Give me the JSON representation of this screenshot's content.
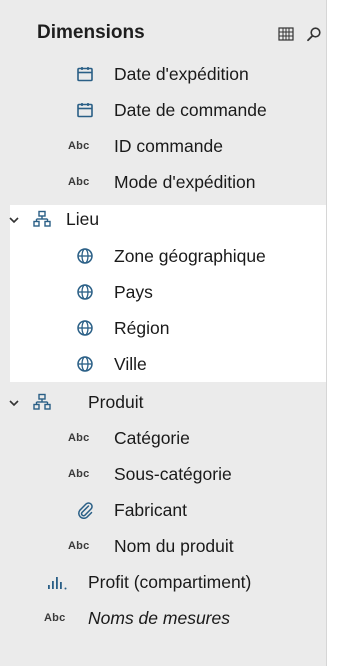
{
  "panel": {
    "title": "Dimensions",
    "tools": [
      {
        "name": "grid-view-icon"
      },
      {
        "name": "search-icon"
      }
    ]
  },
  "items": [
    {
      "label": "Date d'expédition",
      "icon": "calendar-icon",
      "level": 1
    },
    {
      "label": "Date de commande",
      "icon": "calendar-icon",
      "level": 1
    },
    {
      "label": "ID commande",
      "icon": "abc-icon",
      "abc": "Abc",
      "level": 1
    },
    {
      "label": "Mode d'expédition",
      "icon": "abc-icon",
      "abc": "Abc",
      "level": 1
    },
    {
      "label": "Lieu",
      "icon": "hierarchy-icon",
      "level": 0,
      "expanded": true
    },
    {
      "label": "Zone géographique",
      "icon": "globe-icon",
      "level": 1
    },
    {
      "label": "Pays",
      "icon": "globe-icon",
      "level": 1
    },
    {
      "label": "Région",
      "icon": "globe-icon",
      "level": 1
    },
    {
      "label": "Ville",
      "icon": "globe-icon",
      "level": 1
    },
    {
      "label": "Produit",
      "icon": "hierarchy-icon",
      "level": 0,
      "expanded": true
    },
    {
      "label": "Catégorie",
      "icon": "abc-icon",
      "abc": "Abc",
      "level": 1
    },
    {
      "label": "Sous-catégorie",
      "icon": "abc-icon",
      "abc": "Abc",
      "level": 1
    },
    {
      "label": "Fabricant",
      "icon": "paperclip-icon",
      "level": 1
    },
    {
      "label": "Nom du produit",
      "icon": "abc-icon",
      "abc": "Abc",
      "level": 1
    },
    {
      "label": "Profit (compartiment)",
      "icon": "bin-histogram-icon",
      "level": 0
    },
    {
      "label": "Noms de mesures",
      "icon": "abc-icon",
      "abc": "Abc",
      "level": 0,
      "italic": true
    }
  ],
  "colors": {
    "pane_bg": "#ebebeb",
    "highlight_bg": "#ffffff",
    "icon_blue": "#2a5f86"
  }
}
